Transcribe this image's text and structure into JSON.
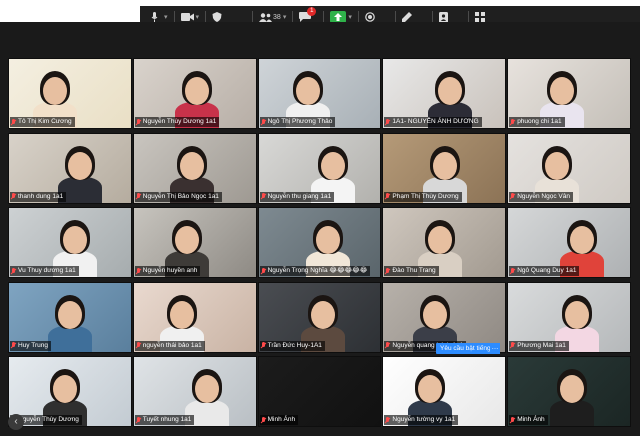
{
  "toolbar": {
    "participants_count": "38",
    "chat_badge": "1",
    "items": [
      {
        "name": "mute-audio",
        "icon": "microphone-icon"
      },
      {
        "name": "stop-video",
        "icon": "video-camera-icon"
      },
      {
        "name": "security",
        "icon": "shield-icon"
      },
      {
        "name": "participants",
        "icon": "people-icon"
      },
      {
        "name": "chat",
        "icon": "chat-bubble-icon"
      },
      {
        "name": "share-screen",
        "icon": "share-arrow-icon"
      },
      {
        "name": "record",
        "icon": "record-icon"
      },
      {
        "name": "annotate",
        "icon": "pencil-icon"
      },
      {
        "name": "reactions",
        "icon": "reaction-icon"
      },
      {
        "name": "apps",
        "icon": "apps-icon"
      }
    ]
  },
  "gallery": {
    "participants": [
      {
        "name": "Tô Thị Kim Cương"
      },
      {
        "name": "Nguyễn Thùy Dương 1a1"
      },
      {
        "name": "Ngô Thị Phương Thảo"
      },
      {
        "name": "1A1- NGUYỄN ÁNH DƯƠNG"
      },
      {
        "name": "phuong chi 1a1"
      },
      {
        "name": "thanh dung 1a1"
      },
      {
        "name": "Nguyễn Thị Bảo Ngọc 1a1"
      },
      {
        "name": "Nguyễn thu giang 1a1"
      },
      {
        "name": "Phạm Thị Thùy Dương"
      },
      {
        "name": "Nguyễn Ngọc Vân"
      },
      {
        "name": "Vu Thuy dương 1a1"
      },
      {
        "name": "Nguyễn huyền anh"
      },
      {
        "name": "Nguyễn Trọng Nghĩa 😂😂😂😂😂"
      },
      {
        "name": "Đào Thu Trang"
      },
      {
        "name": "Ngô Quang Duy 1a1"
      },
      {
        "name": "Huy Trung"
      },
      {
        "name": "nguyễn thái bảo 1a1"
      },
      {
        "name": "Trần Đức Huy-1A1"
      },
      {
        "name": "Nguyễn quang bách 1a1"
      },
      {
        "name": "Phương Mai 1a1"
      },
      {
        "name": "Nguyễn Thùy Dương"
      },
      {
        "name": "Tuyết nhung 1a1"
      },
      {
        "name": "Minh Ánh"
      },
      {
        "name": "Nguyễn tường vy 1a1"
      },
      {
        "name": "Minh Ánh"
      }
    ]
  },
  "tooltip": {
    "label": "Yêu cầu bật tiếng",
    "more": "…"
  },
  "nav": {
    "back_icon": "chevron-left-icon",
    "back_glyph": "‹"
  },
  "colors": {
    "toolbar_bg": "#1f1f1f",
    "meeting_bg": "#1a1a1a",
    "mic_muted": "#ff4a4a",
    "tooltip_bg": "#2d8cff",
    "share_green": "#2fb24a"
  }
}
